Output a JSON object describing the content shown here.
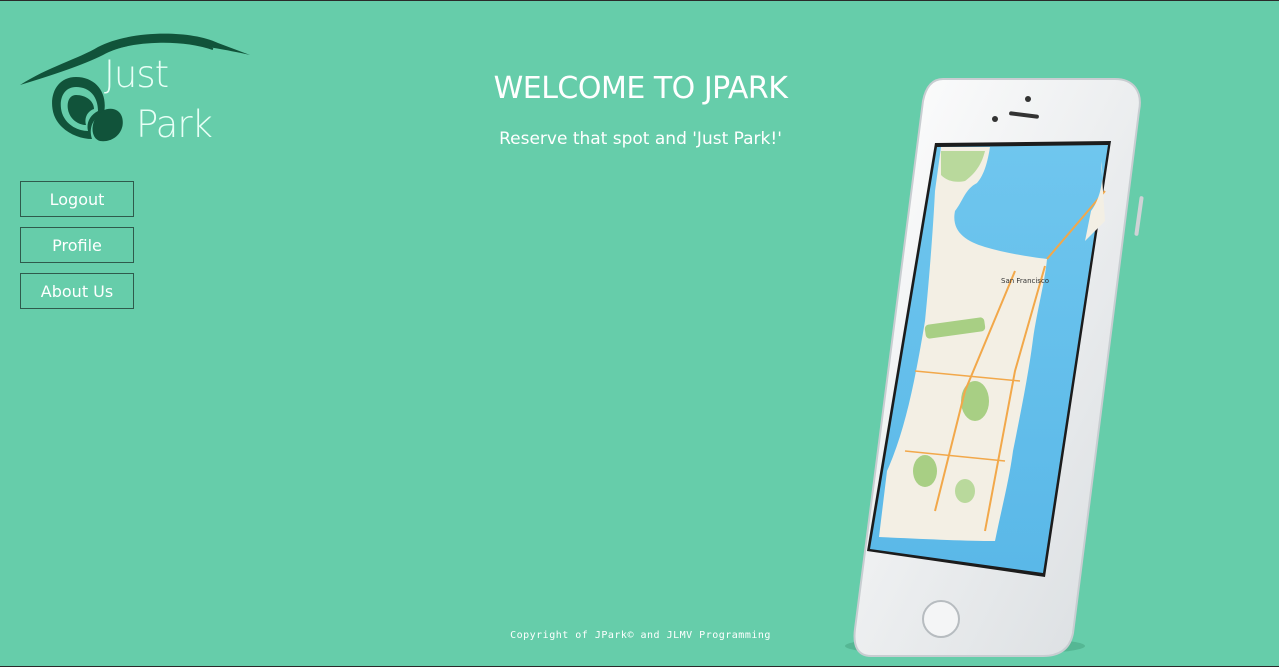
{
  "brand": {
    "logo_line1": "Just",
    "logo_line2": "Park",
    "dark_green": "#11533a",
    "background": "#66cdaa"
  },
  "nav": {
    "items": [
      {
        "label": "Logout"
      },
      {
        "label": "Profile"
      },
      {
        "label": "About Us"
      }
    ]
  },
  "hero": {
    "title": "WELCOME TO JPARK",
    "subtitle": "Reserve that spot and 'Just Park!'"
  },
  "phone": {
    "map_city_label": "San Francisco"
  },
  "footer": {
    "text": "Copyright of JPark© and JLMV Programming"
  }
}
